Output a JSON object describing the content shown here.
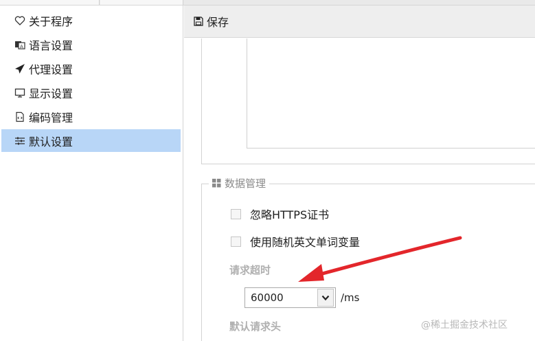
{
  "sidebar": {
    "items": [
      {
        "label": "关于程序",
        "icon": "heart-icon"
      },
      {
        "label": "语言设置",
        "icon": "language-icon"
      },
      {
        "label": "代理设置",
        "icon": "paper-plane-icon"
      },
      {
        "label": "显示设置",
        "icon": "monitor-icon"
      },
      {
        "label": "编码管理",
        "icon": "code-file-icon"
      },
      {
        "label": "默认设置",
        "icon": "sliders-icon",
        "active": true
      }
    ]
  },
  "toolbar": {
    "save_label": "保存",
    "save_icon": "floppy-disk-icon"
  },
  "data_section": {
    "legend": "数据管理",
    "legend_icon": "grid-icon",
    "checkboxes": [
      {
        "label": "忽略HTTPS证书",
        "checked": false
      },
      {
        "label": "使用随机英文单词变量",
        "checked": false
      }
    ],
    "timeout_label": "请求超时",
    "timeout_value": "60000",
    "timeout_unit": "/ms",
    "headers_label": "默认请求头"
  },
  "annotation": {
    "arrow_color": "#e3262b"
  },
  "watermark": "@稀土掘金技术社区",
  "colors": {
    "active_item_bg": "#b8d6f7",
    "toolbar_bg": "#eeeeee"
  }
}
